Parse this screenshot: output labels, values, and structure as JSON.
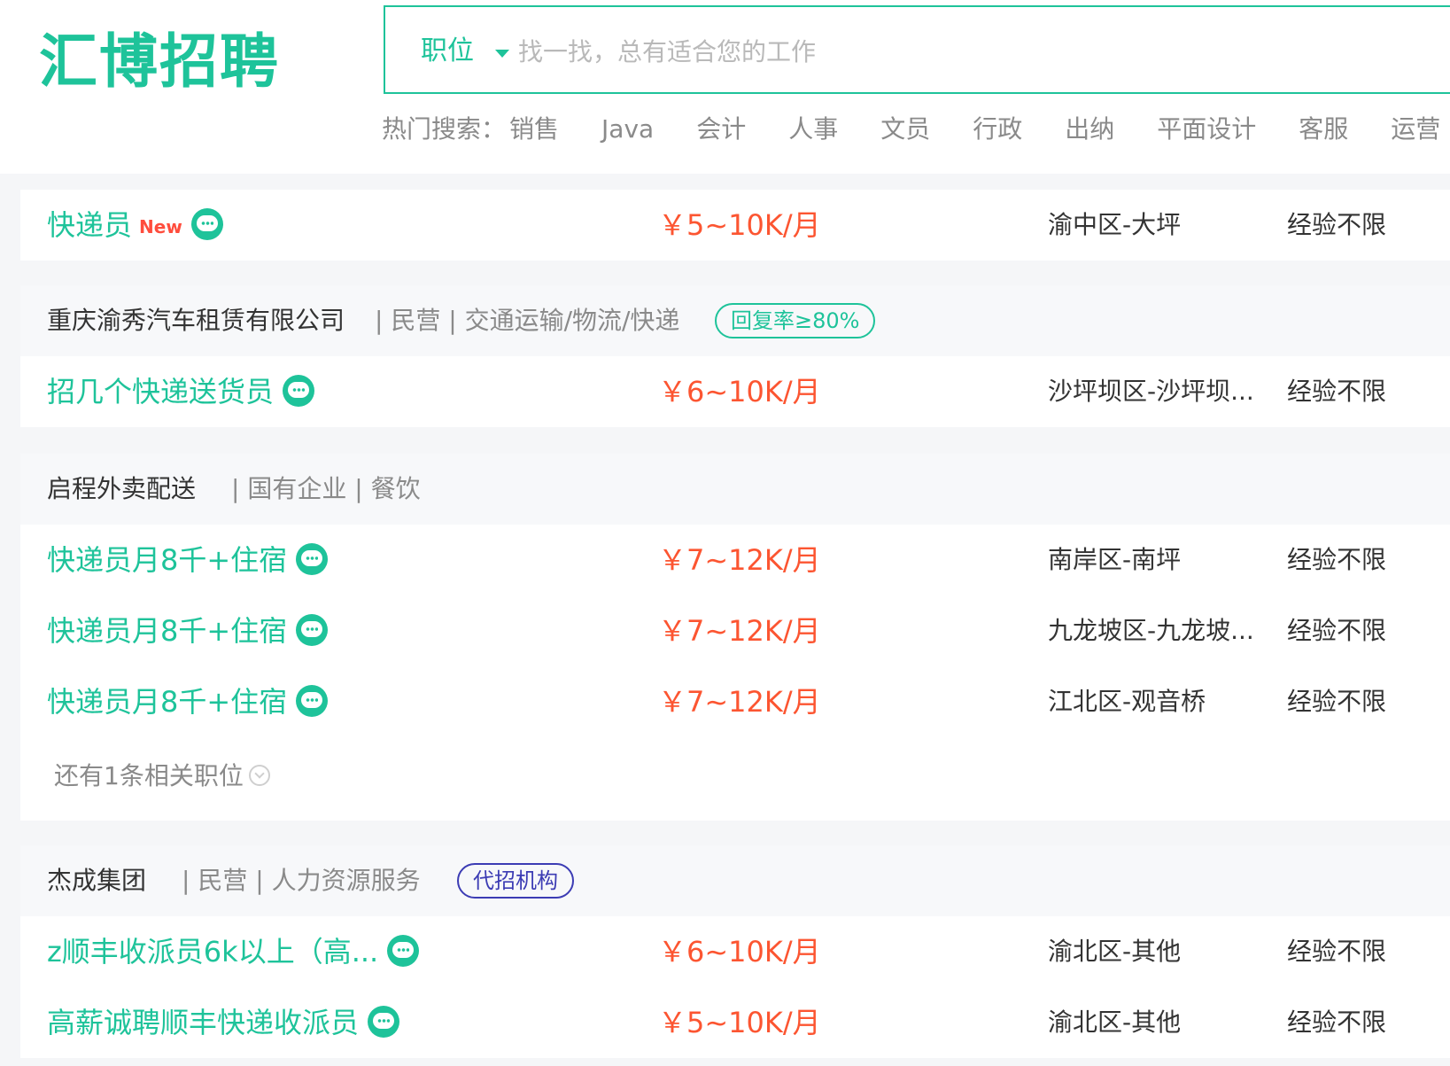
{
  "header": {
    "logo": "汇博招聘",
    "search": {
      "type_label": "职位",
      "placeholder": "找一找，总有适合您的工作"
    },
    "hot_search": {
      "label": "热门搜索：",
      "items": [
        "销售",
        "Java",
        "会计",
        "人事",
        "文员",
        "行政",
        "出纳",
        "平面设计",
        "客服",
        "运营"
      ]
    }
  },
  "jobs": [
    {
      "company": null,
      "rows": [
        {
          "title": "快递员",
          "badge": "New",
          "salary": "￥5~10K/月",
          "location": "渝中区-大坪",
          "experience": "经验不限"
        }
      ]
    },
    {
      "company": {
        "name": "重庆渝秀汽车租赁有限公司",
        "meta": "| 民营 | 交通运输/物流/快递",
        "tag": "回复率≥80%"
      },
      "rows": [
        {
          "title": "招几个快递送货员",
          "salary": "￥6~10K/月",
          "location": "沙坪坝区-沙坪坝...",
          "experience": "经验不限"
        }
      ]
    },
    {
      "company": {
        "name": "启程外卖配送",
        "meta": "| 国有企业 | 餐饮"
      },
      "rows": [
        {
          "title": "快递员月8千+住宿",
          "salary": "￥7~12K/月",
          "location": "南岸区-南坪",
          "experience": "经验不限"
        },
        {
          "title": "快递员月8千+住宿",
          "salary": "￥7~12K/月",
          "location": "九龙坡区-九龙坡...",
          "experience": "经验不限"
        },
        {
          "title": "快递员月8千+住宿",
          "salary": "￥7~12K/月",
          "location": "江北区-观音桥",
          "experience": "经验不限"
        }
      ],
      "more": "还有1条相关职位"
    },
    {
      "company": {
        "name": "杰成集团",
        "meta": "| 民营 | 人力资源服务",
        "tag": "代招机构"
      },
      "rows": [
        {
          "title": "z顺丰收派员6k以上（高...",
          "salary": "￥6~10K/月",
          "location": "渝北区-其他",
          "experience": "经验不限"
        },
        {
          "title": "高薪诚聘顺丰快递收派员",
          "salary": "￥5~10K/月",
          "location": "渝北区-其他",
          "experience": "经验不限"
        }
      ]
    }
  ],
  "colors": {
    "brand": "#1ec39a",
    "salary": "#fc5531",
    "agency_tag": "#3c3cb4"
  }
}
